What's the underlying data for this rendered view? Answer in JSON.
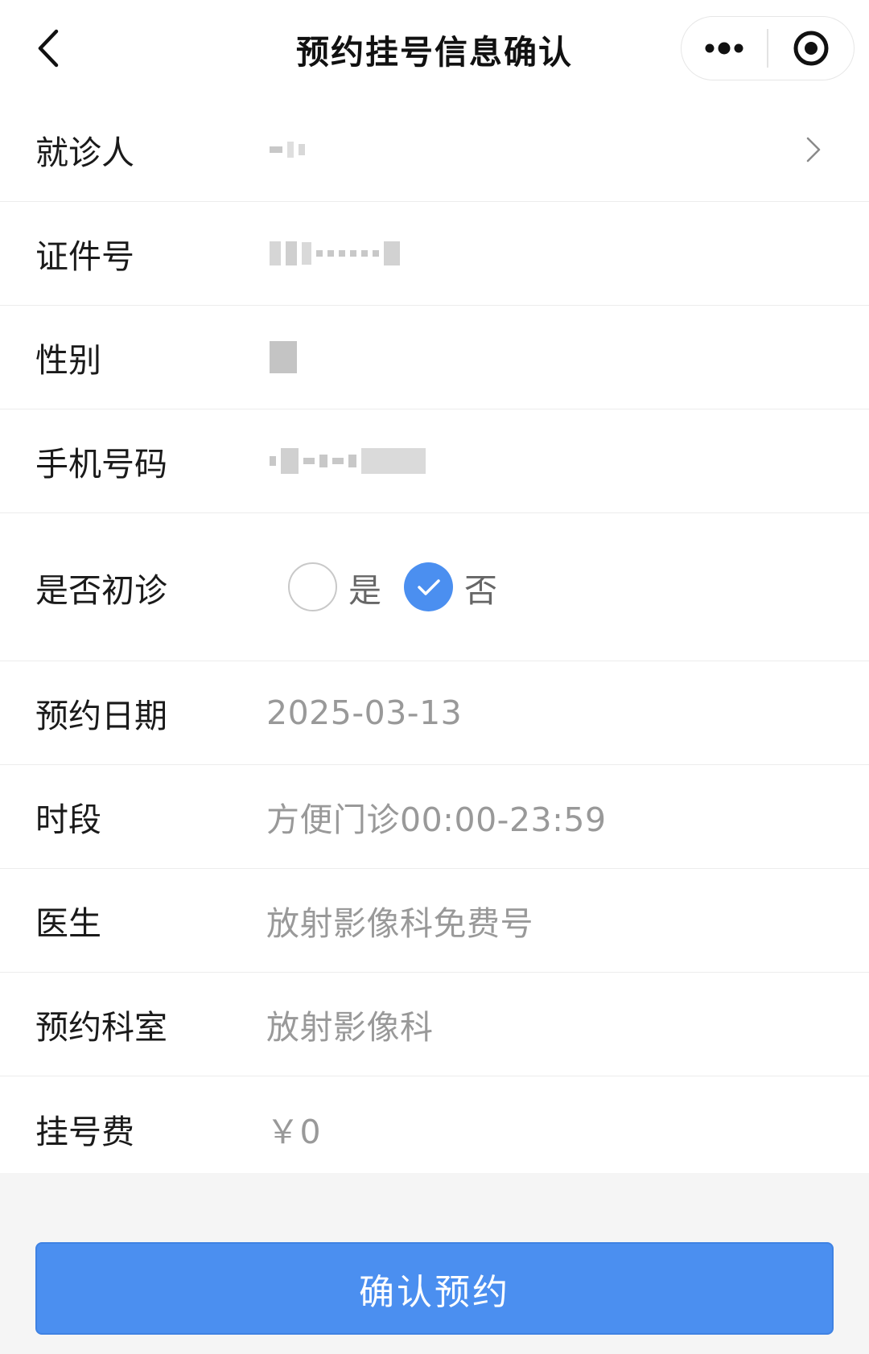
{
  "nav": {
    "title": "预约挂号信息确认"
  },
  "fields": {
    "patient": {
      "label": "就诊人",
      "value": ""
    },
    "id_number": {
      "label": "证件号",
      "value": ""
    },
    "gender": {
      "label": "性别",
      "value": ""
    },
    "phone": {
      "label": "手机号码",
      "value": ""
    },
    "first_visit": {
      "label": "是否初诊",
      "options": [
        {
          "label": "是",
          "checked": false
        },
        {
          "label": "否",
          "checked": true
        }
      ]
    },
    "date": {
      "label": "预约日期",
      "value": "2025-03-13"
    },
    "time_slot": {
      "label": "时段",
      "value": "方便门诊00:00-23:59"
    },
    "doctor": {
      "label": "医生",
      "value": "放射影像科免费号"
    },
    "department": {
      "label": "预约科室",
      "value": "放射影像科"
    },
    "fee": {
      "label": "挂号费",
      "value": "￥0"
    }
  },
  "actions": {
    "confirm_label": "确认预约"
  },
  "colors": {
    "primary": "#4b8ff0",
    "label_text": "#1a1a1a",
    "value_text": "#999999",
    "divider": "#ececec",
    "background": "#f5f5f5"
  },
  "icons": {
    "back": "chevron-left-icon",
    "more": "more-dots-icon",
    "close": "target-circle-icon",
    "row_arrow": "chevron-right-icon",
    "check": "check-icon"
  }
}
